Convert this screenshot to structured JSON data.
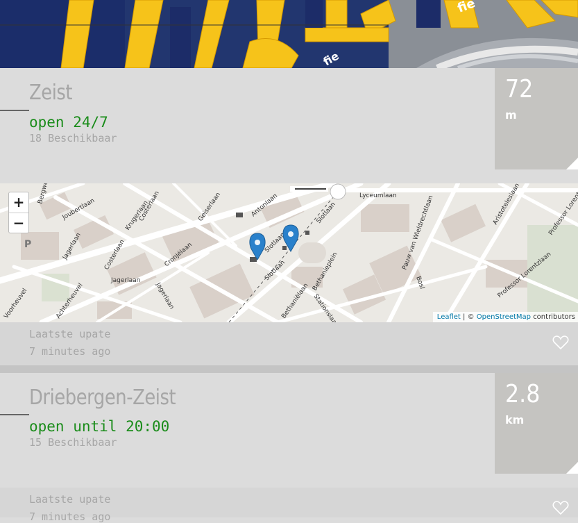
{
  "stations": [
    {
      "name": "Zeist",
      "status": "open 24/7",
      "available": "18 Beschikbaar",
      "distance_value": "72",
      "distance_unit": "m",
      "updated_label": "Laatste upate",
      "updated_ago": "7 minutes ago"
    },
    {
      "name": "Driebergen-Zeist",
      "status": "open until 20:00",
      "available": "15 Beschikbaar",
      "distance_value": "2.8",
      "distance_unit": "km",
      "updated_label": "Laatste upate",
      "updated_ago": "7 minutes ago"
    }
  ],
  "map": {
    "zoom_in": "+",
    "zoom_out": "−",
    "attribution_leaflet": "Leaflet",
    "attribution_sep": "| ©",
    "attribution_osm": "OpenStreetMap",
    "attribution_suffix": "contributors",
    "parking_label": "P",
    "streets": [
      "Bergweg",
      "Joubertlaan",
      "Krugerlaan",
      "Costerlaan",
      "Geiserlaan",
      "Antonlaan",
      "Slotlaan",
      "Lyceumlaan",
      "Aristotelesiaan",
      "Professor Lorentzlaan",
      "Pauw van Wieldrechtlaan",
      "Jagerlaan",
      "Cronjélaan",
      "Achterheuvel",
      "Voorheuvel",
      "Bethanieplein",
      "Stationslaan",
      "Bethaniëlaan",
      "Bosl"
    ]
  },
  "colors": {
    "background": "#dcdcdc",
    "status_green": "#1a8c1a",
    "muted_text": "#a6a6a6",
    "distance_box": "#c5c4c1",
    "marker_blue": "#2a81cb",
    "map_land": "#ebe9e4",
    "map_building": "#d9d0c9"
  }
}
